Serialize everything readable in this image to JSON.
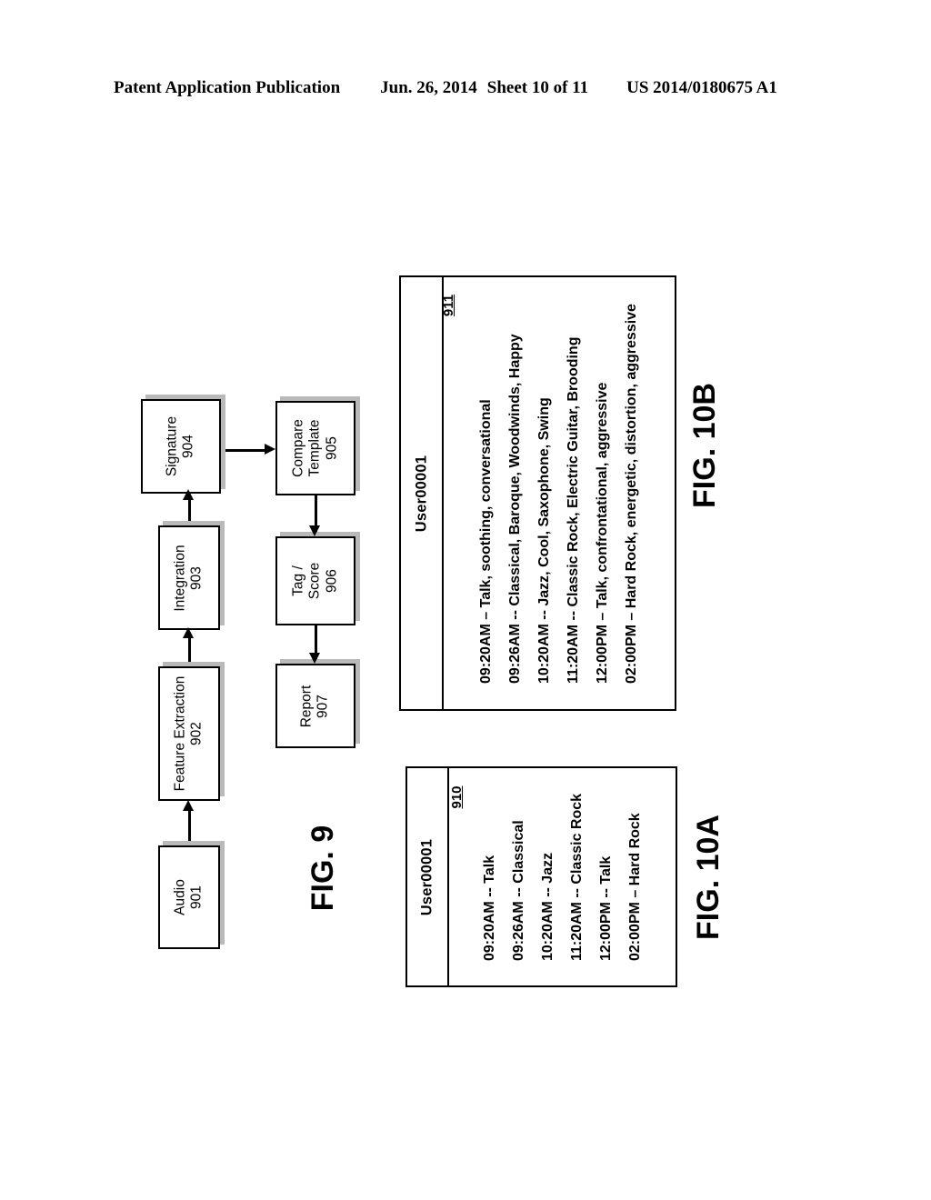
{
  "header": {
    "publication": "Patent Application Publication",
    "date": "Jun. 26, 2014",
    "sheet": "Sheet 10 of 11",
    "patent_number": "US 2014/0180675 A1"
  },
  "fig9": {
    "label": "FIG. 9",
    "boxes": [
      {
        "id": "audio",
        "title": "Audio",
        "ref": "901"
      },
      {
        "id": "feature-extraction",
        "title": "Feature Extraction",
        "ref": "902"
      },
      {
        "id": "integration",
        "title": "Integration",
        "ref": "903"
      },
      {
        "id": "signature",
        "title": "Signature",
        "ref": "904"
      },
      {
        "id": "compare-template",
        "title_line1": "Compare",
        "title_line2": "Template",
        "ref": "905"
      },
      {
        "id": "tag-score",
        "title_line1": "Tag /",
        "title_line2": "Score",
        "ref": "906"
      },
      {
        "id": "report",
        "title": "Report",
        "ref": "907"
      }
    ]
  },
  "fig10a": {
    "label": "FIG. 10A",
    "ref": "910",
    "header": "User00001",
    "rows": [
      "09:20AM -- Talk",
      "09:26AM  -- Classical",
      "10:20AM  -- Jazz",
      "11:20AM  -- Classic Rock",
      "12:00PM -- Talk",
      "02:00PM – Hard Rock"
    ]
  },
  "fig10b": {
    "label": "FIG. 10B",
    "ref": "911",
    "header": "User00001",
    "rows": [
      "09:20AM – Talk, soothing, conversational",
      "09:26AM  -- Classical, Baroque, Woodwinds, Happy",
      "10:20AM  -- Jazz, Cool, Saxophone, Swing",
      "11:20AM  -- Classic Rock, Electric Guitar, Brooding",
      "12:00PM – Talk, confrontational, aggressive",
      "02:00PM – Hard Rock, energetic, distortion, aggressive"
    ]
  }
}
